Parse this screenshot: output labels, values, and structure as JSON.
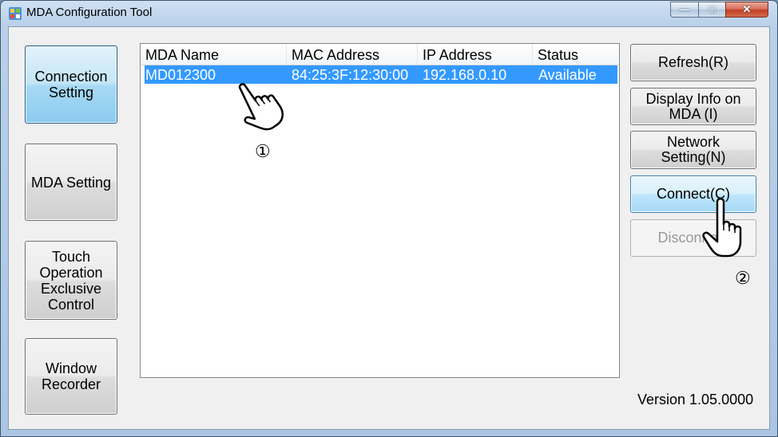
{
  "window": {
    "title": "MDA Configuration Tool",
    "controls": {
      "minimize": "—",
      "maximize": "□",
      "close": "✕"
    }
  },
  "sidebar": {
    "items": [
      {
        "label": "Connection\nSetting",
        "active": true
      },
      {
        "label": "MDA Setting",
        "active": false
      },
      {
        "label": "Touch\nOperation\nExclusive\nControl",
        "active": false
      },
      {
        "label": "Window\nRecorder",
        "active": false
      }
    ]
  },
  "device_list": {
    "columns": [
      "MDA Name",
      "MAC Address",
      "IP Address",
      "Status"
    ],
    "rows": [
      {
        "name": "MD012300",
        "mac": "84:25:3F:12:30:00",
        "ip": "192.168.0.10",
        "status": "Available",
        "selected": true
      }
    ]
  },
  "actions": {
    "refresh": "Refresh(R)",
    "display_info": "Display Info on\nMDA (I)",
    "network_setting": "Network\nSetting(N)",
    "connect": "Connect(C)",
    "disconnect": "Disconnect"
  },
  "annotations": {
    "step1": "①",
    "step2": "②"
  },
  "footer": {
    "version": "Version 1.05.0000"
  },
  "colors": {
    "selection": "#3399ff",
    "active_nav": "#a7d9f5"
  },
  "icons": [
    "app-icon",
    "pointing-hand-icon",
    "pressing-hand-icon"
  ]
}
